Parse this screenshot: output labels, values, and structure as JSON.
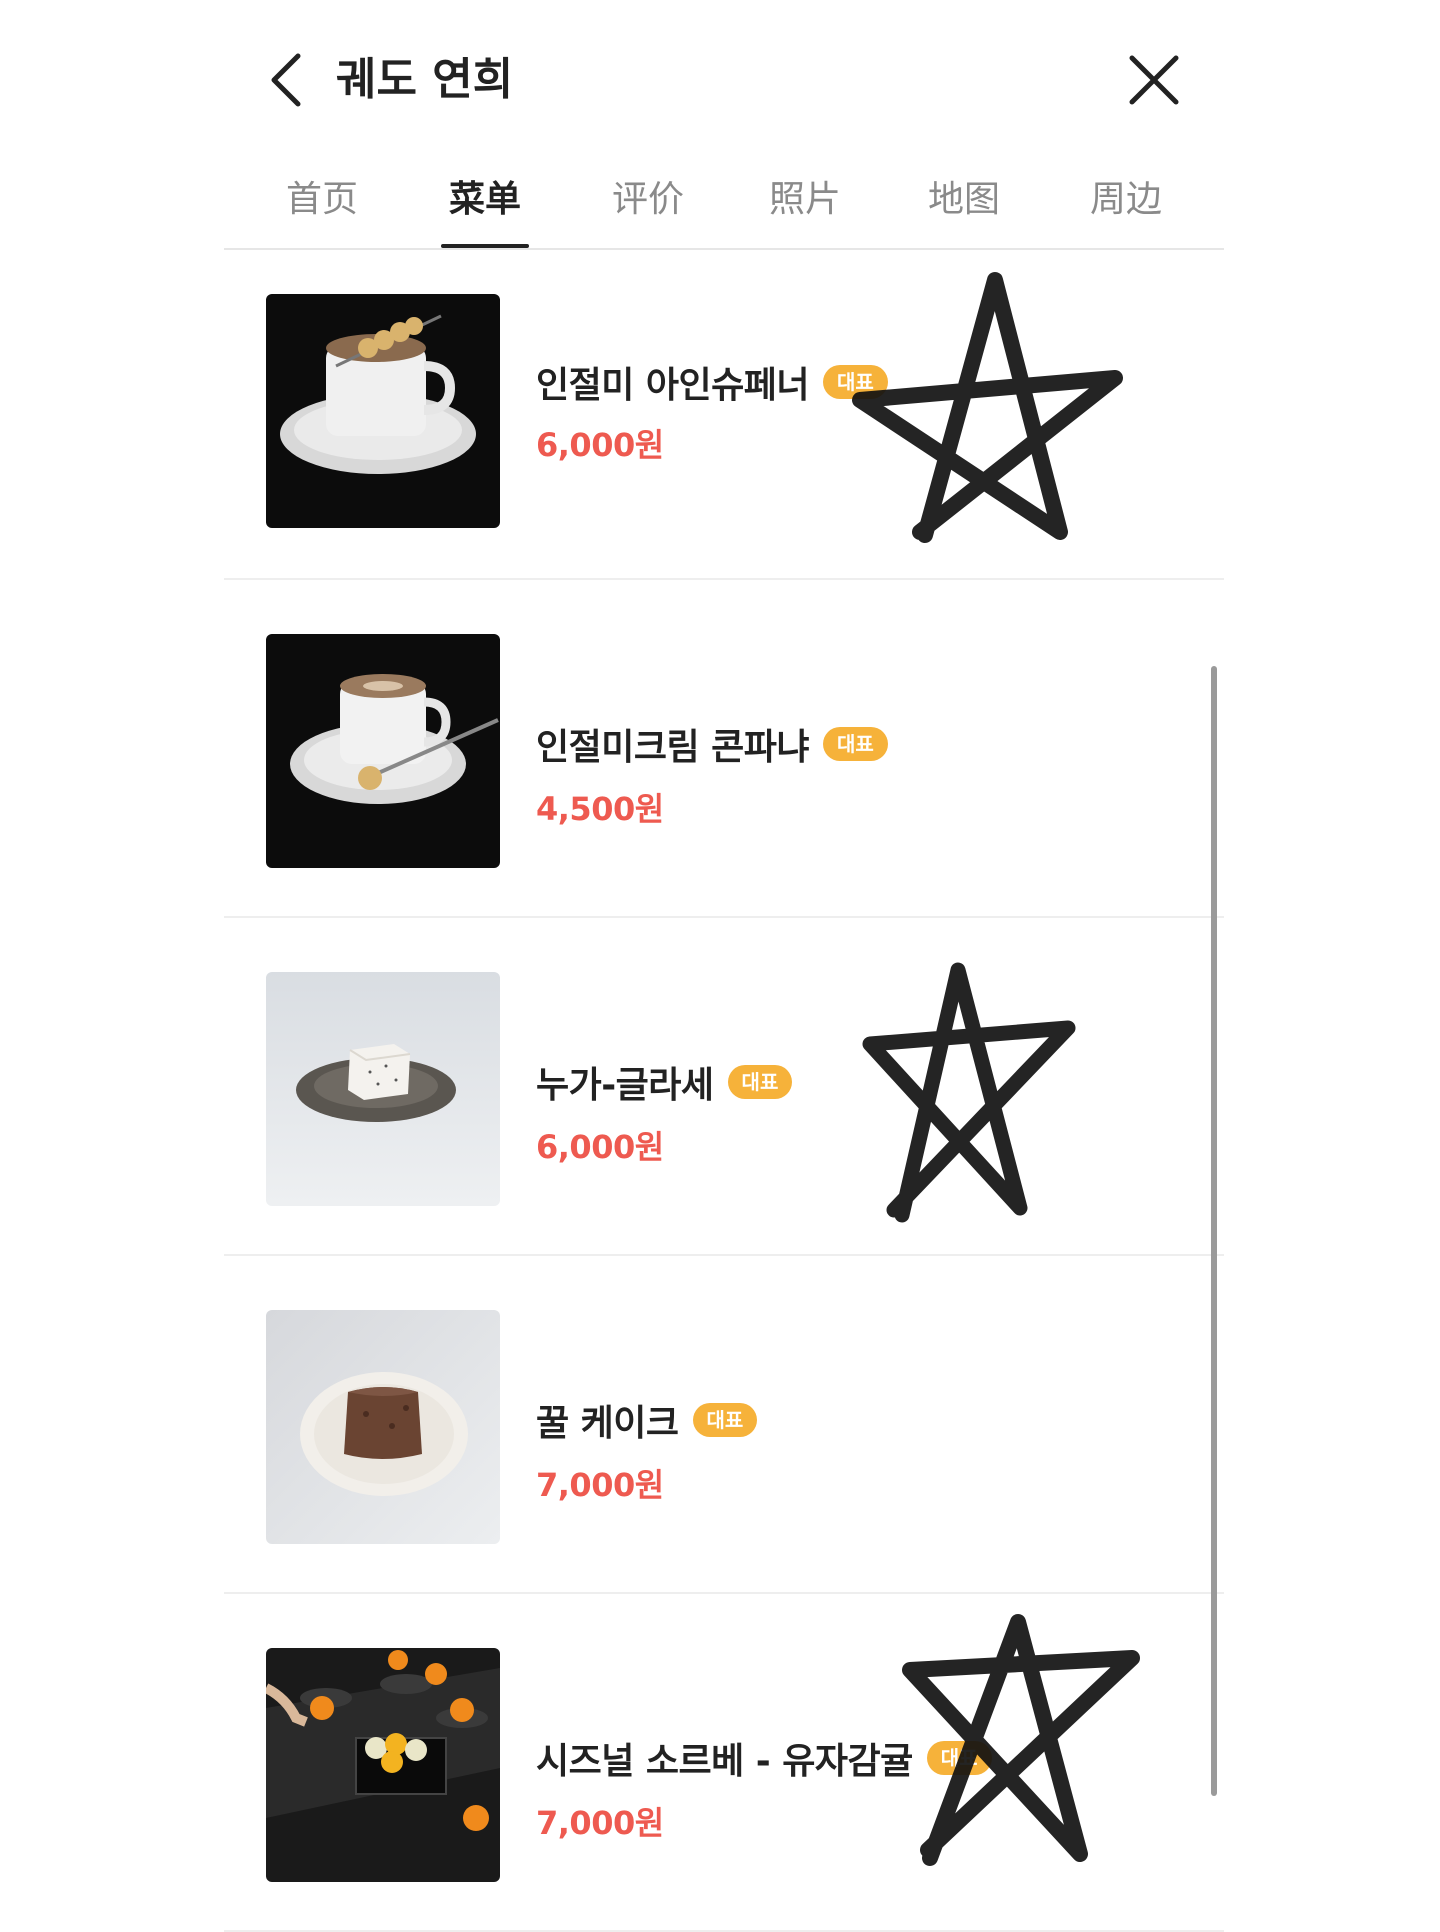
{
  "header": {
    "title": "궤도 연희"
  },
  "tabs": [
    {
      "label": "首页"
    },
    {
      "label": "菜单"
    },
    {
      "label": "评价"
    },
    {
      "label": "照片"
    },
    {
      "label": "地图"
    },
    {
      "label": "周边"
    }
  ],
  "active_tab": "菜单",
  "menu": {
    "items": [
      {
        "name": "인절미 아인슈페너",
        "badge": "대표",
        "price": "6,000원",
        "image": "coffee-cup-with-skewer"
      },
      {
        "name": "인절미크림 콘파냐",
        "badge": "대표",
        "price": "4,500원",
        "image": "espresso-cup-with-spoon"
      },
      {
        "name": "누가-글라세",
        "badge": "대표",
        "price": "6,000원",
        "image": "nougat-glace-on-plate"
      },
      {
        "name": "꿀 케이크",
        "badge": "대표",
        "price": "7,000원",
        "image": "honey-cake-on-plate"
      },
      {
        "name": "시즈널 소르베 - 유자감귤",
        "badge": "대표",
        "price": "7,000원",
        "image": "citrus-sorbet-tray"
      }
    ]
  },
  "colors": {
    "price": "#ee5a50",
    "badge": "#f6b23a",
    "text": "#222222",
    "tab_inactive": "#8a8a8a"
  },
  "icons": {
    "back": "chevron-left-icon",
    "close": "close-icon"
  }
}
